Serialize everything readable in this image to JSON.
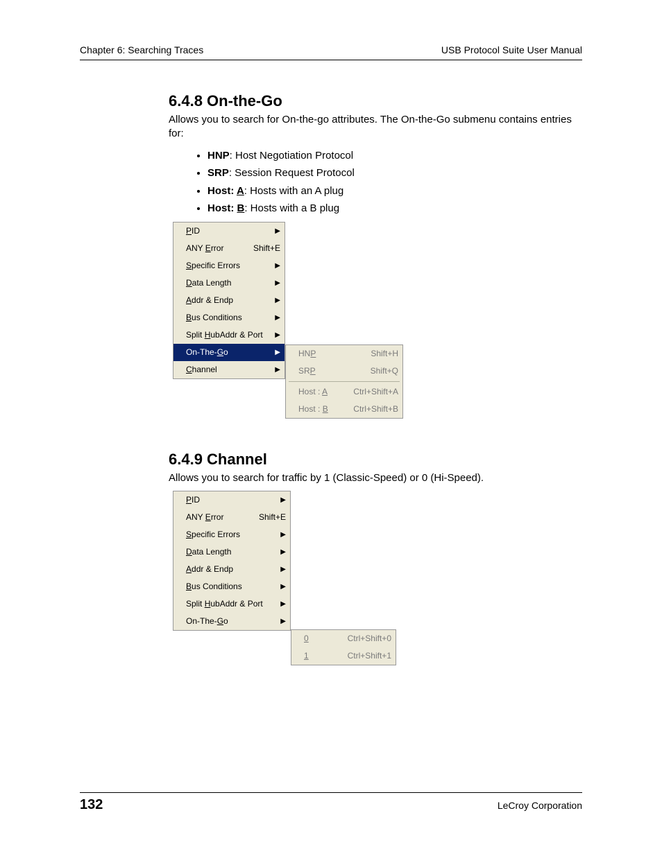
{
  "header": {
    "left": "Chapter 6: Searching Traces",
    "right": "USB Protocol Suite User Manual"
  },
  "section1": {
    "heading": "6.4.8 On-the-Go",
    "intro": "Allows you to search for On-the-go attributes. The On-the-Go submenu contains entries for:",
    "bullets": {
      "b1_bold": "HNP",
      "b1_rest": ": Host Negotiation Protocol",
      "b2_bold": "SRP",
      "b2_rest": ": Session Request Protocol",
      "b3_pre": "Host: ",
      "b3_u": "A",
      "b3_rest": ": Hosts with an A plug",
      "b4_pre": "Host: ",
      "b4_u": "B",
      "b4_rest": ": Hosts with a B plug"
    },
    "menu": {
      "pid_pre": "P",
      "pid_rest": "ID",
      "anye_pre": "ANY ",
      "anye_u": "E",
      "anye_rest": "rror",
      "anye_acc": "Shift+E",
      "se_u": "S",
      "se_rest": "pecific Errors",
      "dl_u": "D",
      "dl_rest": "ata Length",
      "ae_u": "A",
      "ae_rest": "ddr & Endp",
      "bc_u": "B",
      "bc_rest": "us Conditions",
      "sh_pre": "Split ",
      "sh_u": "H",
      "sh_rest": "ubAddr & Port",
      "otg_pre": "On-The-",
      "otg_u": "G",
      "otg_rest": "o",
      "ch_u": "C",
      "ch_rest": "hannel",
      "arrow": "▶"
    },
    "submenu": {
      "hnp_pre": "HN",
      "hnp_u": "P",
      "hnp_acc": "Shift+H",
      "srp_pre": "SR",
      "srp_u": "P",
      "srp_acc": "Shift+Q",
      "ha_pre": "Host : ",
      "ha_u": "A",
      "ha_acc": "Ctrl+Shift+A",
      "hb_pre": "Host : ",
      "hb_u": "B",
      "hb_acc": "Ctrl+Shift+B"
    }
  },
  "section2": {
    "heading": "6.4.9 Channel",
    "intro": "Allows you to search for traffic by 1 (Classic-Speed) or 0 (Hi-Speed).",
    "submenu": {
      "z_u": "0",
      "z_acc": "Ctrl+Shift+0",
      "o_u": "1",
      "o_acc": "Ctrl+Shift+1"
    }
  },
  "footer": {
    "page": "132",
    "corp": "LeCroy Corporation"
  }
}
